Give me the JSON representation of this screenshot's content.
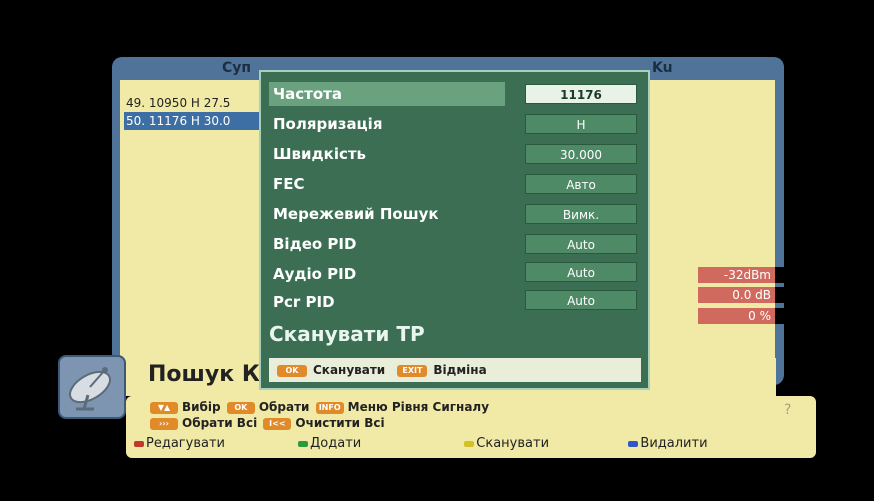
{
  "background_panel": {
    "title_left": "Суп",
    "title_right": "Ku",
    "transponders": [
      {
        "label": "49. 10950 H 27.5"
      },
      {
        "label": "50. 11176 H 30.0"
      }
    ],
    "signal": {
      "level": "-32dBm",
      "quality": "0.0 dB",
      "ber": "0 %"
    }
  },
  "search_title": "Пошук Ка",
  "help": {
    "line1": [
      {
        "key": "▼▲",
        "label": "Вибір"
      },
      {
        "key": "OK",
        "label": "Обрати"
      },
      {
        "key": "INFO",
        "label": "Меню Рівня Сигналу"
      }
    ],
    "line2": [
      {
        "key": "›››",
        "label": "Обрати Всі"
      },
      {
        "key": "I<<",
        "label": "Очистити Всі"
      }
    ],
    "color_buttons": [
      {
        "color": "#c0392b",
        "label": "Редагувати"
      },
      {
        "color": "#2e9a3c",
        "label": "Додати"
      },
      {
        "color": "#d4c12a",
        "label": "Сканувати"
      },
      {
        "color": "#2f57c6",
        "label": "Видалити"
      }
    ],
    "help_icon": "?"
  },
  "dialog": {
    "params": [
      {
        "label": "Частота",
        "value": "11176"
      },
      {
        "label": "Поляризація",
        "value": "H"
      },
      {
        "label": "Швидкість",
        "value": "30.000"
      },
      {
        "label": "FEC",
        "value": "Авто"
      },
      {
        "label": "Мережевий Пошук",
        "value": "Вимк."
      },
      {
        "label": "Відео PID",
        "value": "Auto"
      },
      {
        "label": "Аудіо PID",
        "value": "Auto"
      },
      {
        "label": "Pcr PID",
        "value": "Auto"
      }
    ],
    "scan_title": "Сканувати TP",
    "footer": {
      "ok_key": "OK",
      "ok_label": "Сканувати",
      "exit_key": "EXIT",
      "exit_label": "Відміна"
    }
  },
  "colors": {
    "panel_blue": "#4f7399",
    "list_bg": "#f0eaa6",
    "dialog_green": "#3b6e53",
    "signal_red": "#d06a5e",
    "key_orange": "#e08a2a"
  }
}
